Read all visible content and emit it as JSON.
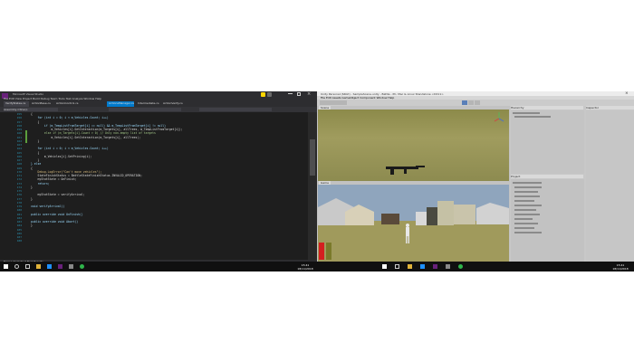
{
  "vs": {
    "title": "Microsoft Visual Studio",
    "menu": [
      "File",
      "Edit",
      "View",
      "Project",
      "Build",
      "Debug",
      "Team",
      "Tools",
      "Test",
      "Analyze",
      "Window",
      "Help"
    ],
    "tabs": [
      "VerifyStates.cs",
      "ActionBase.cs",
      "ActionControl.cs",
      "ActionsManager.cs",
      "Intermediate.cs",
      "ActionVerify.cs"
    ],
    "nav": "Assembly-CSharp",
    "line_numbers": [
      "155",
      "156",
      "157",
      "158",
      "159",
      "160",
      "161",
      "162",
      "163",
      "164",
      "165",
      "166",
      "167",
      "168",
      "169",
      "170",
      "171",
      "172",
      "173",
      "174",
      "175",
      "176",
      "177",
      "178",
      "179",
      "180",
      "181",
      "182",
      "183",
      "184",
      "185",
      "186",
      "187",
      "188"
    ],
    "code": [
      "{",
      "    for (int i = 0; i < m_Vehicles.Count; i++)",
      "    {",
      "        if (m_TempListFromTarget[i] == null) && m_TempListFromTarget[i] != null)",
      "            m_Vehicles[i].SetInteraction(m_Targets[i], allTrees, m_TempListFromTarget[i]);",
      "        else if (m_Targets[i].Count > 0) // Only non-empty list of targets",
      "            m_Vehicles[i].SetInteraction(m_Targets[i], allTrees);",
      "    }",
      "",
      "    for (int i = 0; i < m_Vehicles.Count; i++)",
      "    {",
      "        m_Vehicles[i].SetPriving(i);",
      "    }",
      "} else",
      "{",
      "    Debug.LogError(\"Can't move vehicles\");",
      "    StateFinishStatus = BattleStateFinishStatus.INVALID_OPERATION;",
      "    myStatState = OnFinish;",
      "    return;",
      "}",
      "",
      "    myStatState = verifyArrival;",
      "}",
      "",
      "void verifyArrival()",
      "",
      "public override void OnFinish()",
      "",
      "public override void Abort()",
      "}",
      "",
      "",
      "",
      ""
    ],
    "status_left": "Item(s) Saved",
    "status_tabs": "Error List   Output   Find Results",
    "status_right": "Ln 159   Col 35   Ch 35   INS"
  },
  "unity": {
    "title": "Unity Personal (64bit) - SampleScene.unity - Battle - PC, Mac & Linux Standalone <DX11>",
    "menu": [
      "File",
      "Edit",
      "Assets",
      "GameObject",
      "Component",
      "Window",
      "Help"
    ],
    "scene_tab": "Scene",
    "game_tab": "Game",
    "hierarchy_tab": "Hierarchy",
    "project_tab": "Project",
    "inspector_tab": "Inspector"
  },
  "taskbar": {
    "time_left": "15:41",
    "date_left": "18/11/2018",
    "time_right": "15:41",
    "date_right": "18/11/2018"
  },
  "colors": {
    "vs_bg": "#1e1e1e",
    "vs_status": "#007acc",
    "unity_panel": "#c2c2c2",
    "taskbar": "#101010"
  }
}
